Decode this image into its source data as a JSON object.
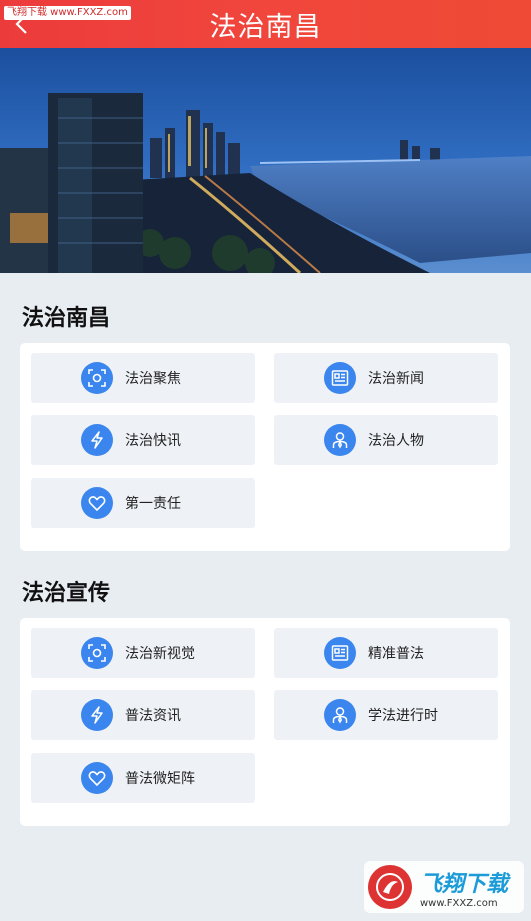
{
  "header": {
    "title": "法治南昌",
    "back_icon": "chevron-left-icon"
  },
  "watermark_top": "飞翔下载 www.FXXZ.com",
  "watermark_bottom": {
    "name": "飞翔下载",
    "url": "www.FXXZ.com"
  },
  "sections": [
    {
      "title": "法治南昌",
      "items": [
        {
          "label": "法治聚焦",
          "icon": "focus-icon"
        },
        {
          "label": "法治新闻",
          "icon": "newspaper-icon"
        },
        {
          "label": "法治快讯",
          "icon": "lightning-icon"
        },
        {
          "label": "法治人物",
          "icon": "person-icon"
        },
        {
          "label": "第一责任",
          "icon": "heart-icon"
        }
      ]
    },
    {
      "title": "法治宣传",
      "items": [
        {
          "label": "法治新视觉",
          "icon": "focus-icon"
        },
        {
          "label": "精准普法",
          "icon": "newspaper-icon"
        },
        {
          "label": "普法资讯",
          "icon": "lightning-icon"
        },
        {
          "label": "学法进行时",
          "icon": "person-icon"
        },
        {
          "label": "普法微矩阵",
          "icon": "heart-icon"
        }
      ]
    }
  ],
  "colors": {
    "header": "#ec3b3b",
    "icon_bg": "#3b86ee",
    "tile_bg": "#eef1f6",
    "page_bg": "#e8edf2"
  }
}
